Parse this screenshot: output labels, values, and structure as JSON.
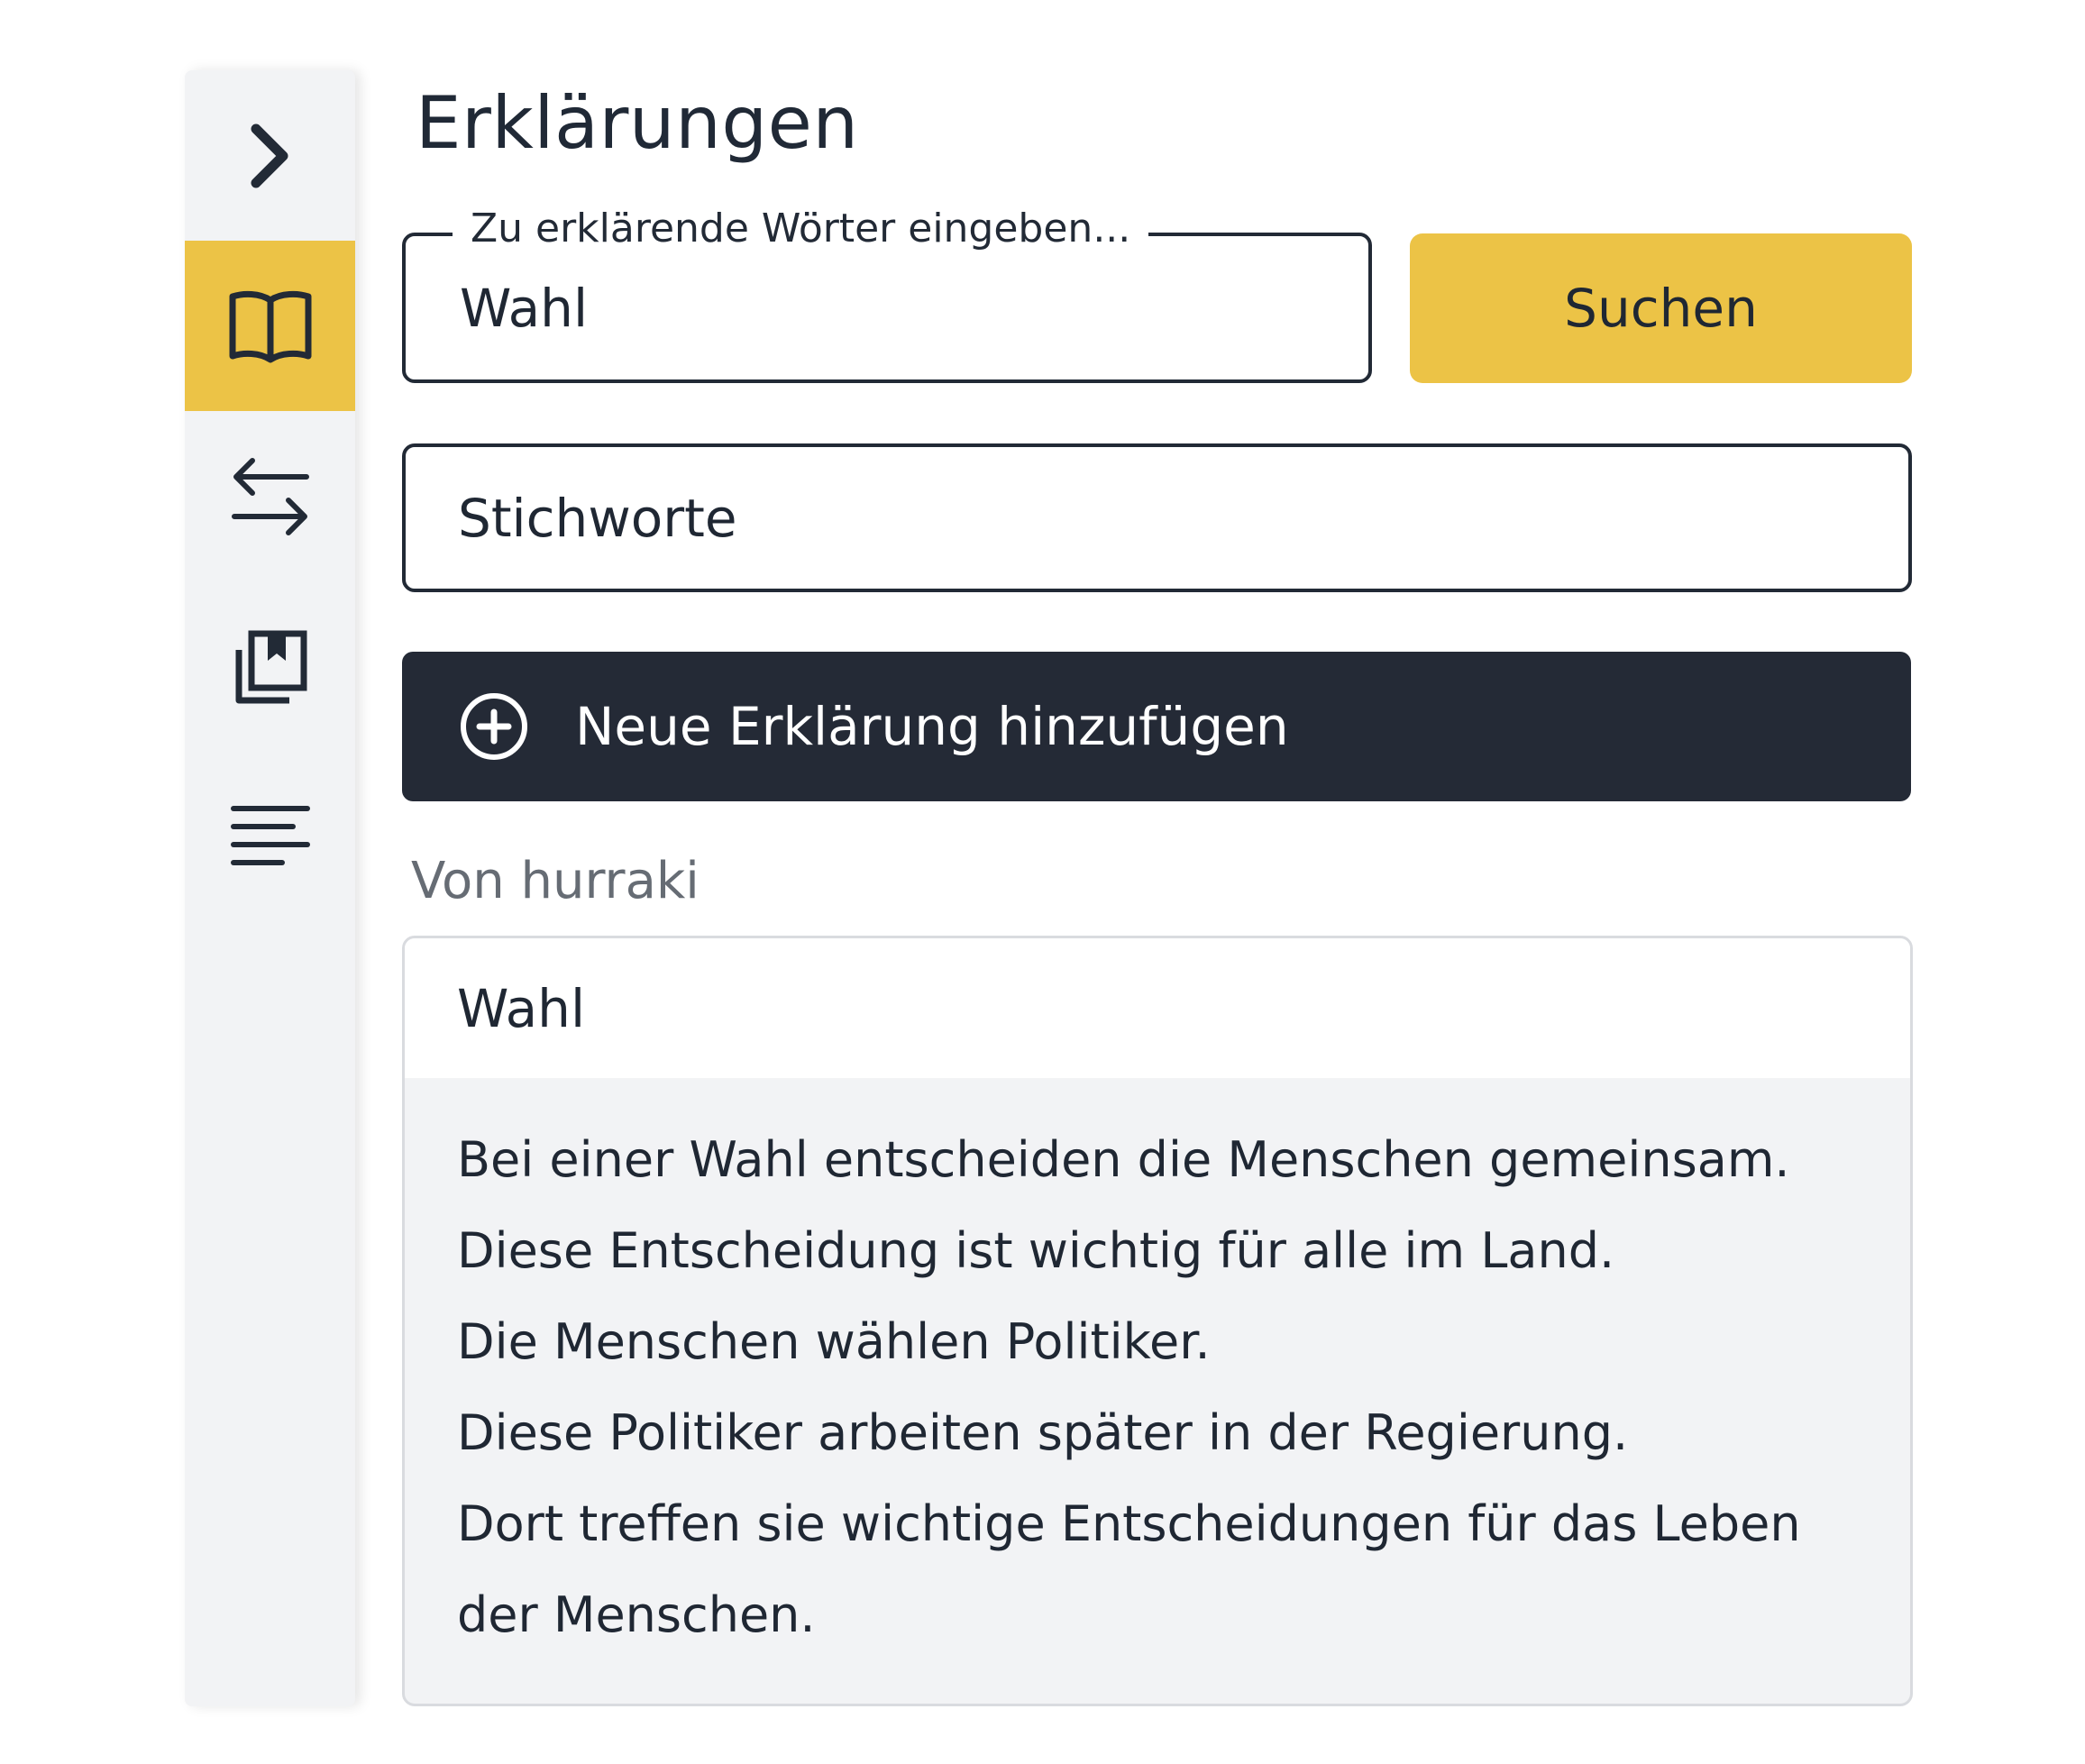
{
  "sidebar": {
    "items": [
      {
        "icon": "chevron-right-icon",
        "active": false
      },
      {
        "icon": "book-open-icon",
        "active": true
      },
      {
        "icon": "arrows-swap-icon",
        "active": false
      },
      {
        "icon": "bookmark-collection-icon",
        "active": false
      },
      {
        "icon": "text-lines-icon",
        "active": false
      }
    ],
    "active_color": "#ecc346"
  },
  "main": {
    "title": "Erklärungen",
    "search": {
      "label": "Zu erklärende Wörter eingeben...",
      "value": "Wahl",
      "button_label": "Suchen"
    },
    "keywords": {
      "label": "Stichworte"
    },
    "add_button": {
      "icon": "plus-circle-icon",
      "label": "Neue Erklärung hinzufügen"
    },
    "source_label": "Von hurraki",
    "result": {
      "term": "Wahl",
      "lines": [
        "Bei einer Wahl entscheiden die Menschen gemeinsam.",
        "Diese Entscheidung ist wichtig für alle im Land.",
        "Die Menschen wählen Politiker.",
        "Diese Politiker arbeiten später in der Regierung.",
        "Dort treffen sie wichtige Entscheidungen für das Leben",
        "der Menschen."
      ]
    }
  },
  "colors": {
    "accent": "#ecc346",
    "dark": "#242a36",
    "muted_text": "#666c74"
  }
}
